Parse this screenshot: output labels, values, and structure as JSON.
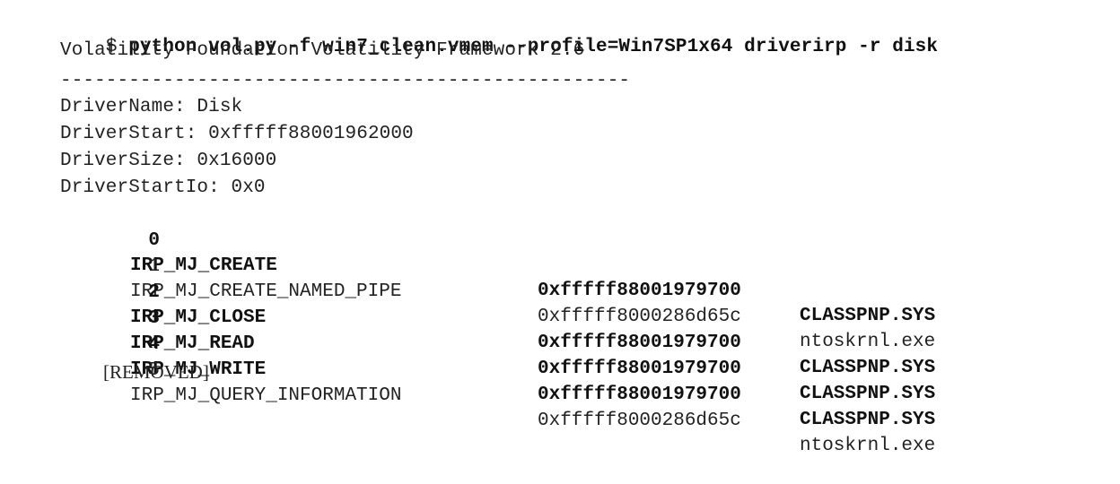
{
  "command": {
    "prompt": "$ ",
    "text": "python vol.py -f win7_clean.vmem --profile=Win7SP1x64 driverirp -r disk"
  },
  "banner": "Volatility Foundation Volatility Framework 2.6",
  "separator": "--------------------------------------------------",
  "driver": {
    "name_line": "DriverName: Disk",
    "start_line": "DriverStart: 0xfffff88001962000",
    "size_line": "DriverSize: 0x16000",
    "startio_line": "DriverStartIo: 0x0"
  },
  "irp_rows": [
    {
      "index": "0",
      "name": "IRP_MJ_CREATE",
      "address": "0xfffff88001979700",
      "module": "CLASSPNP.SYS",
      "bold": true
    },
    {
      "index": "1",
      "name": "IRP_MJ_CREATE_NAMED_PIPE",
      "address": "0xfffff8000286d65c",
      "module": "ntoskrnl.exe",
      "bold": false
    },
    {
      "index": "2",
      "name": "IRP_MJ_CLOSE",
      "address": "0xfffff88001979700",
      "module": "CLASSPNP.SYS",
      "bold": true
    },
    {
      "index": "3",
      "name": "IRP_MJ_READ",
      "address": "0xfffff88001979700",
      "module": "CLASSPNP.SYS",
      "bold": true
    },
    {
      "index": "4",
      "name": "IRP_MJ_WRITE",
      "address": "0xfffff88001979700",
      "module": "CLASSPNP.SYS",
      "bold": true
    },
    {
      "index": "5",
      "name": "IRP_MJ_QUERY_INFORMATION",
      "address": "0xfffff8000286d65c",
      "module": "ntoskrnl.exe",
      "bold": false
    }
  ],
  "removed": "[REMOVED]"
}
